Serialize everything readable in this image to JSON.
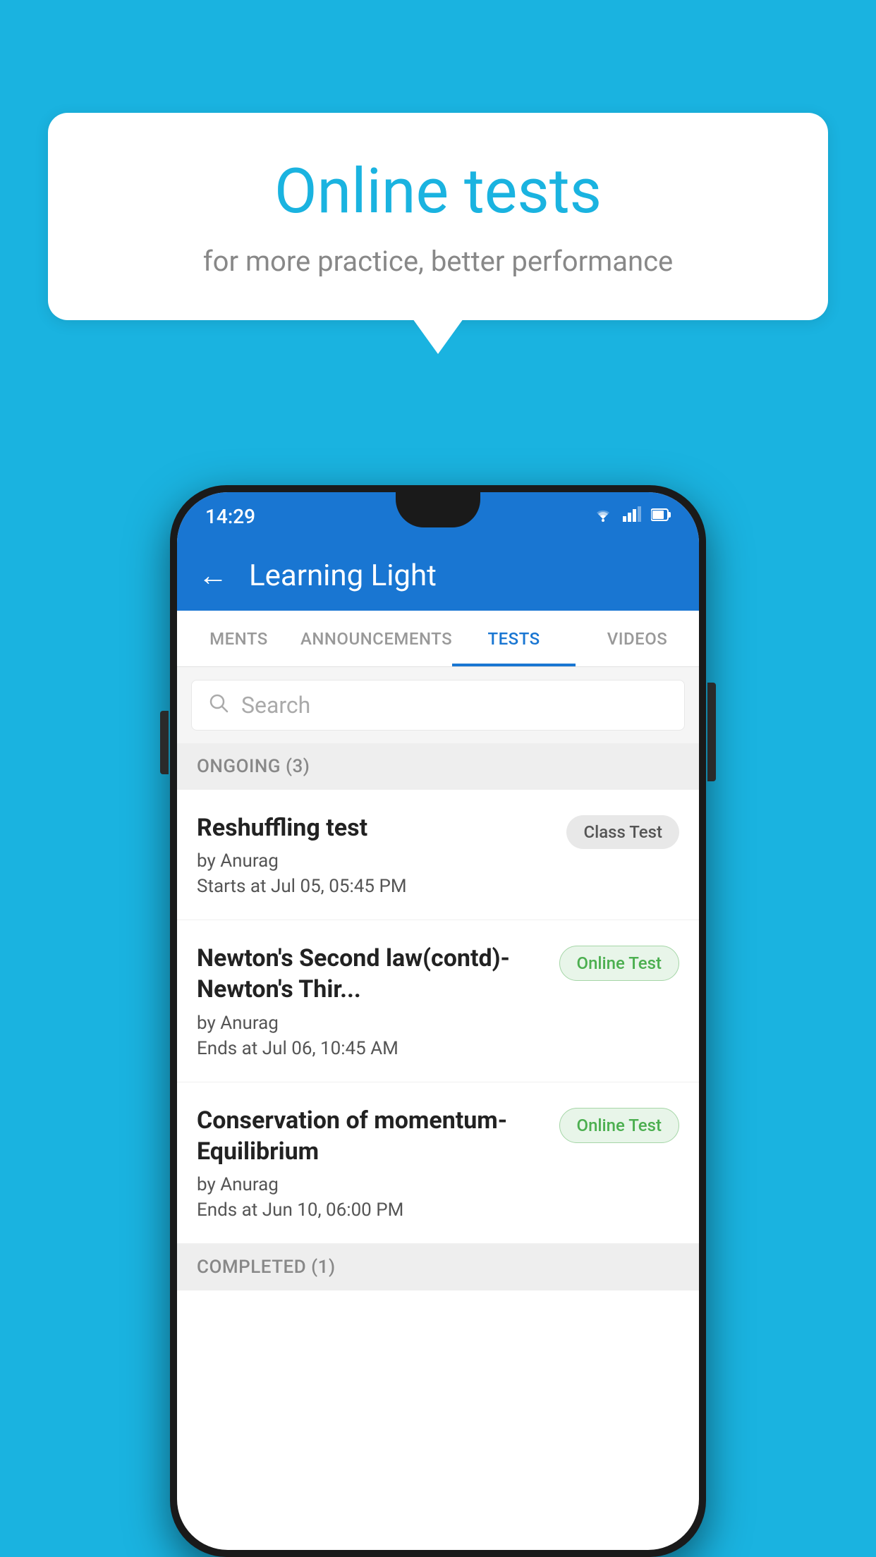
{
  "background": {
    "color": "#1ab3e0"
  },
  "speech_bubble": {
    "title": "Online tests",
    "subtitle": "for more practice, better performance"
  },
  "phone": {
    "status_bar": {
      "time": "14:29",
      "icons": [
        "wifi",
        "signal",
        "battery"
      ]
    },
    "app_bar": {
      "back_label": "←",
      "title": "Learning Light"
    },
    "tabs": [
      {
        "label": "MENTS",
        "active": false
      },
      {
        "label": "ANNOUNCEMENTS",
        "active": false
      },
      {
        "label": "TESTS",
        "active": true
      },
      {
        "label": "VIDEOS",
        "active": false
      }
    ],
    "search": {
      "placeholder": "Search"
    },
    "ongoing_section": {
      "title": "ONGOING (3)"
    },
    "tests": [
      {
        "name": "Reshuffling test",
        "author": "by Anurag",
        "date": "Starts at  Jul 05, 05:45 PM",
        "badge": "Class Test",
        "badge_type": "class"
      },
      {
        "name": "Newton's Second law(contd)-Newton's Thir...",
        "author": "by Anurag",
        "date": "Ends at  Jul 06, 10:45 AM",
        "badge": "Online Test",
        "badge_type": "online"
      },
      {
        "name": "Conservation of momentum-Equilibrium",
        "author": "by Anurag",
        "date": "Ends at  Jun 10, 06:00 PM",
        "badge": "Online Test",
        "badge_type": "online"
      }
    ],
    "completed_section": {
      "title": "COMPLETED (1)"
    }
  }
}
